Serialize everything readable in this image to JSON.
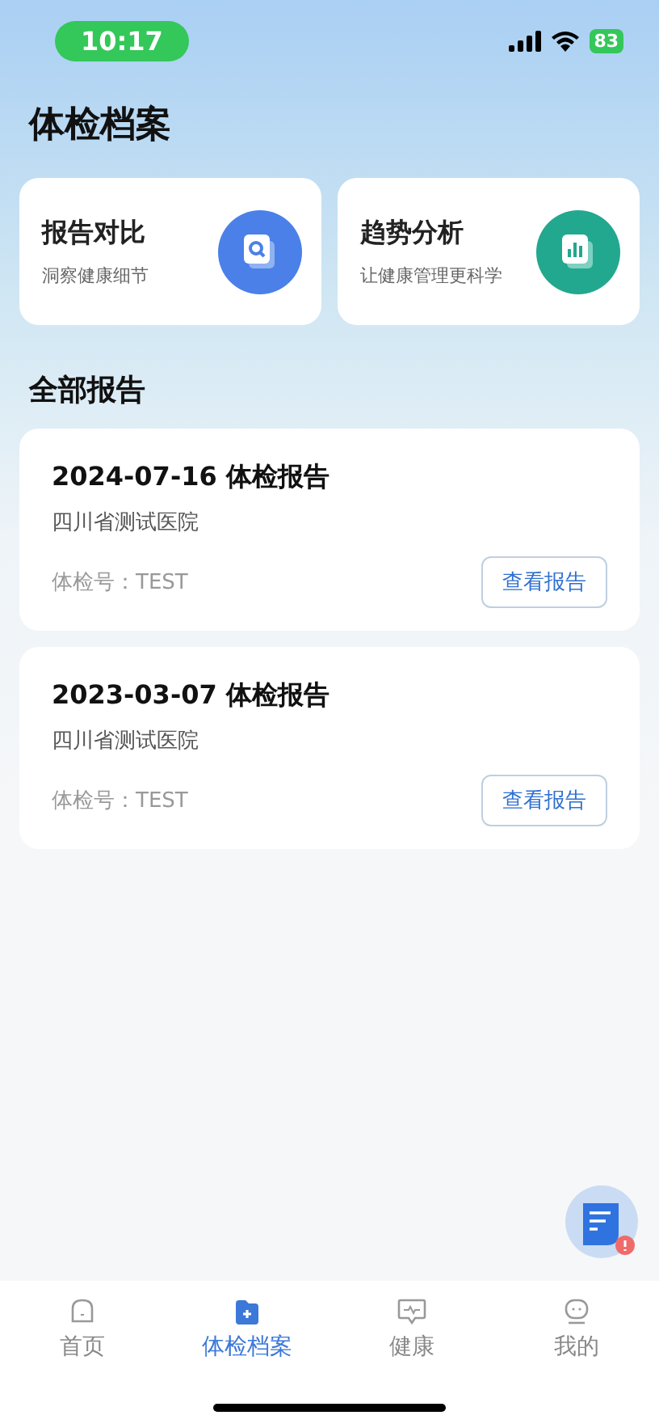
{
  "status_bar": {
    "time": "10:17",
    "battery": "83"
  },
  "title": "体检档案",
  "features": [
    {
      "kind": "compare",
      "title": "报告对比",
      "subtitle": "洞察健康细节"
    },
    {
      "kind": "trend",
      "title": "趋势分析",
      "subtitle": "让健康管理更科学"
    }
  ],
  "section_title": "全部报告",
  "reports": [
    {
      "title": "2024-07-16 体检报告",
      "hospital": "四川省测试医院",
      "number": "体检号：TEST",
      "button": "查看报告"
    },
    {
      "title": "2023-03-07 体检报告",
      "hospital": "四川省测试医院",
      "number": "体检号：TEST",
      "button": "查看报告"
    }
  ],
  "tabs": [
    {
      "kind": "home",
      "label": "首页",
      "selected": false
    },
    {
      "kind": "records",
      "label": "体检档案",
      "selected": true
    },
    {
      "kind": "health",
      "label": "健康",
      "selected": false
    },
    {
      "kind": "profile",
      "label": "我的",
      "selected": false
    }
  ]
}
